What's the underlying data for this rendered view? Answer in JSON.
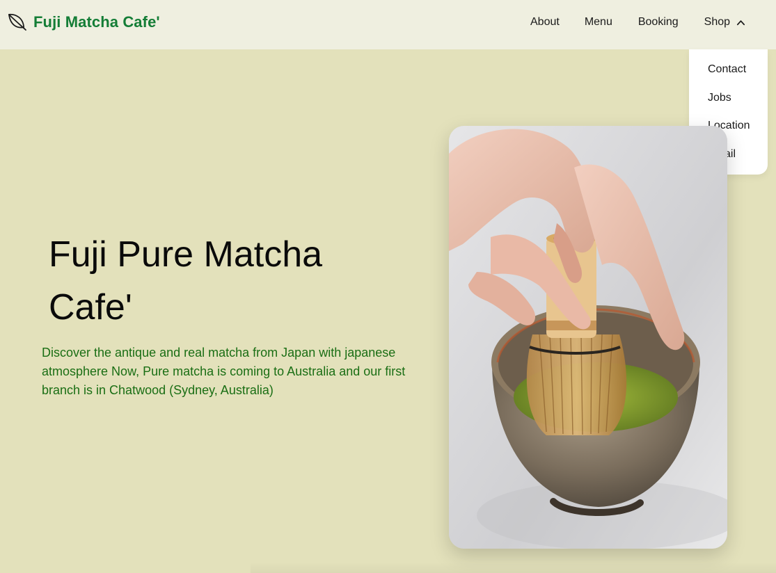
{
  "header": {
    "brand_name": "Fuji Matcha Cafe'",
    "logo_icon": "leaf-icon",
    "nav": {
      "about": "About",
      "menu": "Menu",
      "booking": "Booking",
      "shop": "Shop",
      "shop_icon": "chevron-up-icon"
    }
  },
  "dropdown": {
    "items": [
      "Contact",
      "Jobs",
      "Location",
      "Email"
    ]
  },
  "hero": {
    "title": "Fuji Pure Matcha Cafe'",
    "description": "Discover the antique and real matcha from Japan with japanese atmosphere Now, Pure matcha is coming to Australia and our first branch is in Chatwood (Sydney, Australia)",
    "image_subject": "matcha-whisk-photo"
  },
  "colors": {
    "background": "#e3e1bb",
    "header_background": "#efefe0",
    "brand_green": "#147d36",
    "description_green": "#1a6e14",
    "dropdown_background": "#ffffff"
  }
}
